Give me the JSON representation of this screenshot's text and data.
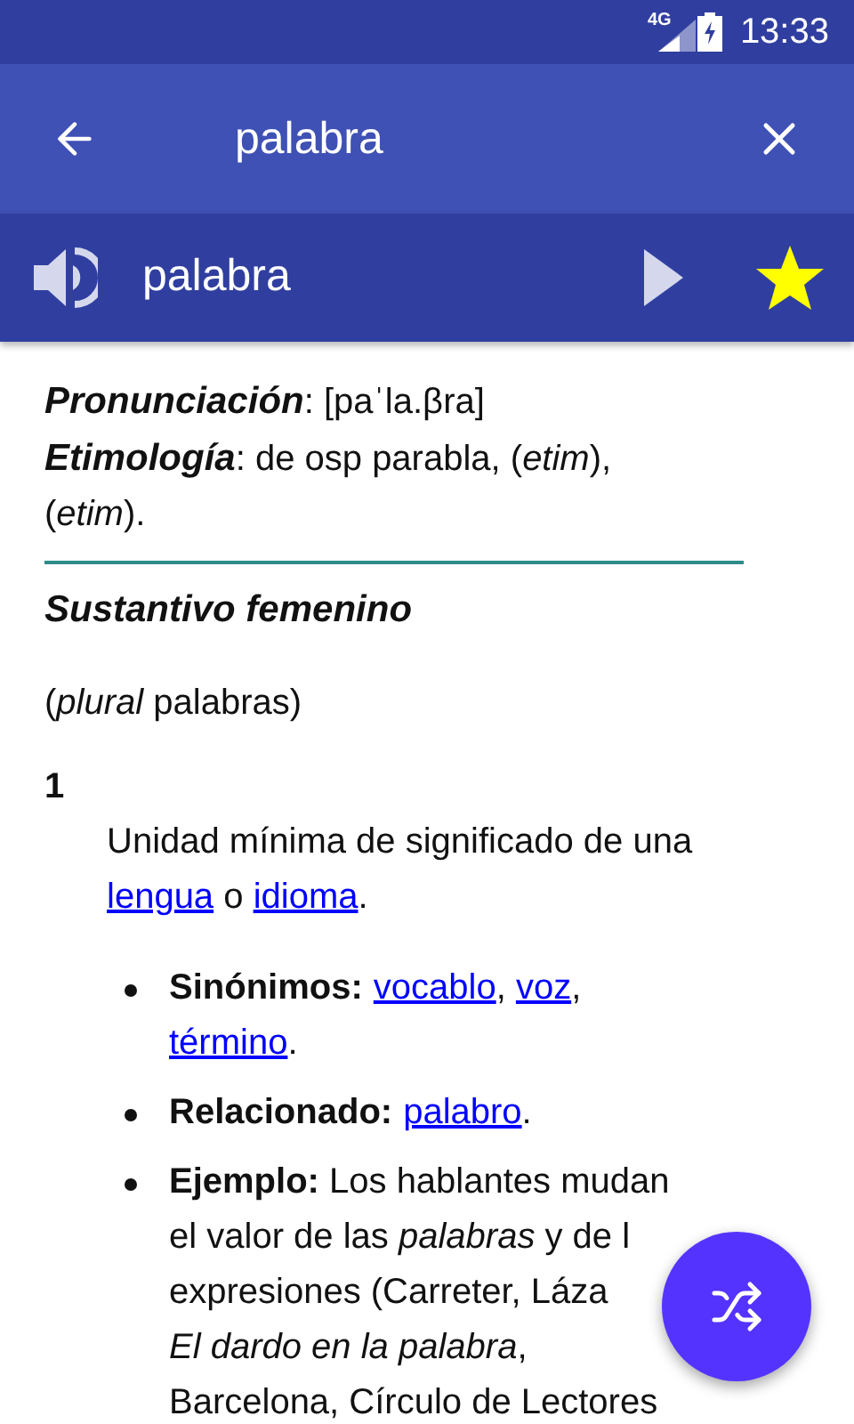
{
  "status_bar": {
    "network": "4G",
    "time": "13:33"
  },
  "toolbar": {
    "search_value": "palabra"
  },
  "headword": {
    "text": "palabra",
    "favorite": true
  },
  "entry": {
    "pronunciation": {
      "label": "Pronunciación",
      "text": ": [paˈla.βra]"
    },
    "etymology": {
      "label": "Etimología",
      "text": ": de osp parabla, (*etim*), (*etim*)."
    },
    "part_of_speech": "Sustantivo femenino",
    "plural": "(*plural* palabras)",
    "senses": [
      {
        "number": "1",
        "definition": [
          {
            "kind": "text",
            "text": "Unidad mínima de significado de una "
          },
          {
            "kind": "link",
            "text": "lengua"
          },
          {
            "kind": "text",
            "text": " o "
          },
          {
            "kind": "link",
            "text": "idioma"
          },
          {
            "kind": "text",
            "text": "."
          }
        ],
        "bullets": [
          {
            "label": "Sinónimos:",
            "segments": [
              {
                "kind": "link",
                "text": "vocablo"
              },
              {
                "kind": "text",
                "text": ", "
              },
              {
                "kind": "link",
                "text": "voz"
              },
              {
                "kind": "text",
                "text": ", "
              },
              {
                "kind": "link",
                "text": "término"
              },
              {
                "kind": "text",
                "text": "."
              }
            ]
          },
          {
            "label": "Relacionado:",
            "segments": [
              {
                "kind": "link",
                "text": "palabro"
              },
              {
                "kind": "text",
                "text": "."
              }
            ]
          },
          {
            "label": "Ejemplo:",
            "lines": [
              " Los hablantes mudan",
              "el valor de las *palabras* y de l",
              "expresiones (Carreter, Láza",
              "*El dardo en la palabra*,",
              "Barcelona, Círculo de Lectores"
            ]
          }
        ]
      }
    ]
  }
}
